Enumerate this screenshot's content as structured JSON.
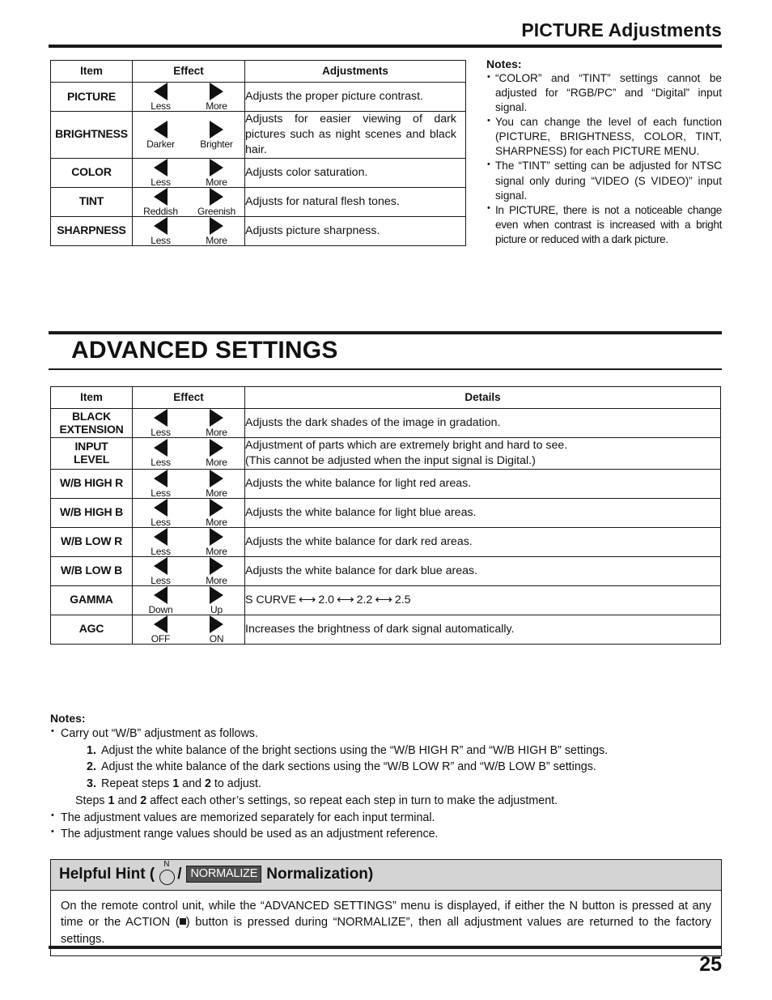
{
  "header": {
    "running_title": "PICTURE Adjustments"
  },
  "picture_table": {
    "columns": [
      "Item",
      "Effect",
      "Adjustments"
    ],
    "rows": [
      {
        "item": "PICTURE",
        "left_label": "Less",
        "right_label": "More",
        "detail": "Adjusts the proper picture contrast."
      },
      {
        "item": "BRIGHTNESS",
        "left_label": "Darker",
        "right_label": "Brighter",
        "detail": "Adjusts for easier viewing of dark pictures such as night scenes and black hair."
      },
      {
        "item": "COLOR",
        "left_label": "Less",
        "right_label": "More",
        "detail": "Adjusts color saturation."
      },
      {
        "item": "TINT",
        "left_label": "Reddish",
        "right_label": "Greenish",
        "detail": "Adjusts for natural flesh tones."
      },
      {
        "item": "SHARPNESS",
        "left_label": "Less",
        "right_label": "More",
        "detail": "Adjusts picture sharpness."
      }
    ]
  },
  "side_notes": {
    "heading": "Notes:",
    "items": [
      "“COLOR” and “TINT” settings cannot be adjusted for “RGB/PC” and “Digital” input signal.",
      "You can change the level of each function (PICTURE, BRIGHTNESS, COLOR, TINT, SHARPNESS) for each PICTURE MENU.",
      "The “TINT” setting can be adjusted for NTSC signal only during “VIDEO (S VIDEO)” input signal.",
      "In PICTURE, there is not a noticeable change even when contrast is increased with a bright picture or reduced with a dark picture."
    ]
  },
  "advanced": {
    "section_title": "ADVANCED SETTINGS",
    "columns": [
      "Item",
      "Effect",
      "Details"
    ],
    "rows": [
      {
        "item": "BLACK EXTENSION",
        "left_label": "Less",
        "right_label": "More",
        "detail": "Adjusts the dark shades of the image in gradation."
      },
      {
        "item": "INPUT LEVEL",
        "left_label": "Less",
        "right_label": "More",
        "detail": "Adjustment of parts which are extremely bright and hard to see.\n(This cannot be adjusted when the input signal is Digital.)"
      },
      {
        "item": "W/B HIGH R",
        "left_label": "Less",
        "right_label": "More",
        "detail": "Adjusts the white balance for light red areas."
      },
      {
        "item": "W/B HIGH B",
        "left_label": "Less",
        "right_label": "More",
        "detail": "Adjusts the white balance for light blue areas."
      },
      {
        "item": "W/B LOW R",
        "left_label": "Less",
        "right_label": "More",
        "detail": "Adjusts the white balance for dark red areas."
      },
      {
        "item": "W/B LOW B",
        "left_label": "Less",
        "right_label": "More",
        "detail": "Adjusts the white balance for dark blue areas."
      },
      {
        "item": "GAMMA",
        "left_label": "Down",
        "right_label": "Up",
        "detail": "S CURVE ⟷ 2.0 ⟷ 2.2 ⟷ 2.5",
        "gamma_steps": [
          "S CURVE",
          "2.0",
          "2.2",
          "2.5"
        ]
      },
      {
        "item": "AGC",
        "left_label": "OFF",
        "right_label": "ON",
        "detail": "Increases the brightness of dark signal automatically."
      }
    ]
  },
  "bottom_notes": {
    "heading": "Notes:",
    "bullet1": "Carry out “W/B” adjustment as follows.",
    "steps": [
      {
        "num": "1.",
        "text": "Adjust the white balance of the bright sections using the “W/B HIGH R” and “W/B HIGH B” settings."
      },
      {
        "num": "2.",
        "text": "Adjust the white balance of the dark sections using the “W/B LOW R” and “W/B LOW B” settings."
      },
      {
        "num": "3.",
        "text": "Repeat steps 1 and 2 to adjust."
      }
    ],
    "steps_tail": "Steps 1 and 2 affect each other’s settings, so repeat each step in turn to make the adjustment.",
    "bullet2": "The adjustment values are memorized separately for each input terminal.",
    "bullet3": "The adjustment range values should be used as an adjustment reference."
  },
  "helpful_hint": {
    "title_prefix": "Helpful Hint (",
    "slash": "/",
    "normalize_chip": "NORMALIZE",
    "title_suffix": "Normalization)",
    "n_cap": "N",
    "body_part1": "On the remote control unit, while the “ADVANCED SETTINGS” menu is displayed, if either the N button is pressed at any time or the ACTION (",
    "body_part2": ") button is pressed during “NORMALIZE”, then all adjustment values are returned to the factory settings."
  },
  "footer": {
    "page_number": "25"
  }
}
